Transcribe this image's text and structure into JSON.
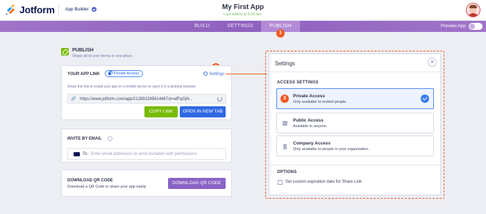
{
  "header": {
    "logo_text": "Jotform",
    "app_builder_label": "App Builder",
    "app_title": "My First App",
    "last_edited": "Last edited at 6:26 am.",
    "avatar": "user-avatar"
  },
  "nav": {
    "tabs": [
      {
        "label": "BUILD"
      },
      {
        "label": "SETTINGS"
      },
      {
        "label": "PUBLISH",
        "active": true
      }
    ],
    "preview_label": "Preview App"
  },
  "steps": [
    "1",
    "2",
    "3"
  ],
  "publish": {
    "title": "PUBLISH",
    "subtitle": "Share all of your forms in one place."
  },
  "app_link": {
    "label": "YOUR APP LINK",
    "access_pill": "Private Access",
    "settings_link": "Settings",
    "description": "Share this link to install your app on a mobile device or open it in a desktop browser.",
    "url": "https://www.jotform.com/app/212992285614667st=afFqGjN...",
    "copy_button": "COPY LINK",
    "open_button": "OPEN IN NEW TAB"
  },
  "invite": {
    "label": "INVITE BY EMAIL",
    "to_label": "To:",
    "placeholder": "Enter email addresses to send invitation with permissions."
  },
  "qr": {
    "title": "DOWNLOAD QR CODE",
    "subtitle": "Download a QR Code to share your app easily",
    "button": "DOWNLOAD QR CODE"
  },
  "settings_panel": {
    "title": "Settings",
    "close": "×",
    "access_section": "ACCESS SETTINGS",
    "options": [
      {
        "title": "Private Access",
        "desc": "Only available to invited people.",
        "selected": true
      },
      {
        "title": "Public Access",
        "desc": "Available to anyone.",
        "selected": false
      },
      {
        "title": "Company Access",
        "desc": "Only available to people in your organization.",
        "selected": false
      }
    ],
    "options_section": "OPTIONS",
    "expiration_label": "Set custom expiration date for Share Link"
  },
  "colors": {
    "brand_purple": "#8f61be",
    "accent_orange": "#f05a22",
    "green": "#78bb07",
    "blue": "#2e69e3"
  }
}
